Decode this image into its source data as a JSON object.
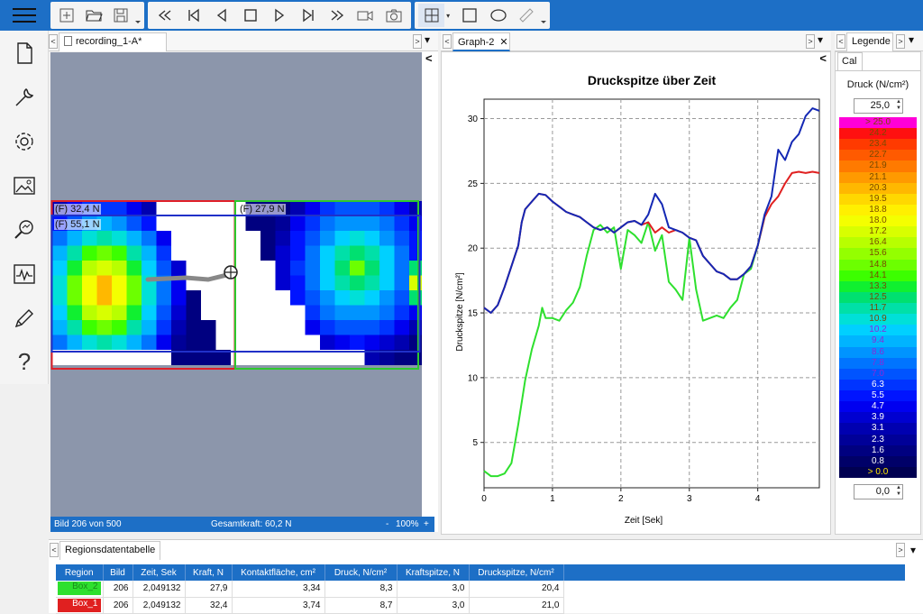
{
  "toolbar": {
    "buttons": [
      "add-icon",
      "folder-open-icon",
      "save-icon",
      "fast-rewind-icon",
      "skip-start-icon",
      "step-back-icon",
      "stop-icon",
      "play-icon",
      "skip-end-icon",
      "fast-forward-icon",
      "video-camera-icon",
      "camera-icon",
      "grid-icon",
      "rectangle-icon",
      "ellipse-icon",
      "ruler-icon"
    ]
  },
  "sidebar": {
    "items": [
      "file-icon",
      "wrench-icon",
      "gear-icon",
      "image-icon",
      "zoom-analysis-icon",
      "chart-icon",
      "pencil-icon",
      "help-icon"
    ],
    "help_glyph": "?"
  },
  "tabs": {
    "recording": "recording_1-A*",
    "graph": "Graph-2",
    "graph_close": "✕",
    "legend": "Legende",
    "cal": "Cal",
    "regions": "Regionsdatentabelle",
    "left_arrow": "<",
    "right_arrow": ">",
    "menu_arrow": "▾"
  },
  "image": {
    "box_f1": "(F) 32,4 N",
    "box_f2": "(F) 55,1 N",
    "box_f3": "(F) 27,9 N",
    "colors": {
      "red": "#e0202a",
      "green": "#2ec82e",
      "blue": "#2030c8"
    }
  },
  "status": {
    "frame": "Bild 206 von 500",
    "total_force": "Gesamtkraft: 60,2 N",
    "zoom_minus": "-",
    "zoom": "100%",
    "zoom_plus": "+"
  },
  "legend": {
    "unit": "Druck (N/cm²)",
    "max_value": "25,0",
    "min_value": "0,0",
    "labels": [
      "> 25.0",
      "24.2",
      "23.4",
      "22.7",
      "21.9",
      "21.1",
      "20.3",
      "19.5",
      "18.8",
      "18.0",
      "17.2",
      "16.4",
      "15.6",
      "14.8",
      "14.1",
      "13.3",
      "12.5",
      "11.7",
      "10.9",
      "10.2",
      "9.4",
      "8.6",
      "7.8",
      "7.0",
      "6.3",
      "5.5",
      "4.7",
      "3.9",
      "3.1",
      "2.3",
      "1.6",
      "0.8",
      "> 0.0"
    ],
    "colors": [
      "#ff00d8",
      "#ff1010",
      "#ff3a00",
      "#ff5a00",
      "#ff7a00",
      "#ff9a00",
      "#ffb800",
      "#ffd800",
      "#fff000",
      "#f4ff00",
      "#d8ff00",
      "#b8ff00",
      "#94ff00",
      "#6cff00",
      "#3cff00",
      "#10f030",
      "#00e070",
      "#00e0a8",
      "#00e0d8",
      "#00d0ff",
      "#00b4ff",
      "#0094ff",
      "#0074ff",
      "#0054ff",
      "#0034ff",
      "#0014ff",
      "#0000f0",
      "#0000d0",
      "#0000b0",
      "#000098",
      "#000080",
      "#000068",
      "#000050"
    ]
  },
  "chart_data": {
    "type": "line",
    "title": "Druckspitze über Zeit",
    "xlabel": "Zeit [Sek]",
    "ylabel": "Druckspitze [N/cm²]",
    "xlim": [
      0,
      4.9
    ],
    "ylim": [
      1.5,
      31.5
    ],
    "xticks": [
      0,
      1,
      2,
      3,
      4
    ],
    "yticks": [
      5,
      10,
      15,
      20,
      25,
      30
    ],
    "grid": true,
    "series": [
      {
        "color": "#1428b4",
        "points": [
          [
            0,
            15.4
          ],
          [
            0.1,
            15.0
          ],
          [
            0.2,
            15.6
          ],
          [
            0.3,
            17.0
          ],
          [
            0.4,
            18.6
          ],
          [
            0.5,
            20.2
          ],
          [
            0.55,
            22.0
          ],
          [
            0.6,
            23.0
          ],
          [
            0.7,
            23.6
          ],
          [
            0.8,
            24.2
          ],
          [
            0.9,
            24.1
          ],
          [
            1.0,
            23.6
          ],
          [
            1.1,
            23.2
          ],
          [
            1.2,
            22.8
          ],
          [
            1.3,
            22.6
          ],
          [
            1.4,
            22.4
          ],
          [
            1.5,
            22.0
          ],
          [
            1.6,
            21.6
          ],
          [
            1.7,
            21.4
          ],
          [
            1.8,
            21.6
          ],
          [
            1.9,
            21.2
          ],
          [
            2.0,
            21.6
          ],
          [
            2.1,
            22.0
          ],
          [
            2.2,
            22.1
          ],
          [
            2.3,
            21.8
          ],
          [
            2.4,
            22.6
          ],
          [
            2.5,
            24.2
          ],
          [
            2.6,
            23.4
          ],
          [
            2.7,
            21.6
          ],
          [
            2.8,
            21.4
          ],
          [
            2.9,
            21.2
          ],
          [
            3.0,
            20.8
          ],
          [
            3.1,
            20.6
          ],
          [
            3.2,
            19.4
          ],
          [
            3.3,
            18.8
          ],
          [
            3.4,
            18.2
          ],
          [
            3.5,
            18.0
          ],
          [
            3.6,
            17.6
          ],
          [
            3.7,
            17.6
          ],
          [
            3.8,
            18.0
          ],
          [
            3.9,
            18.6
          ],
          [
            4.0,
            20.2
          ],
          [
            4.1,
            22.6
          ],
          [
            4.2,
            24.0
          ],
          [
            4.3,
            27.6
          ],
          [
            4.4,
            26.8
          ],
          [
            4.5,
            28.2
          ],
          [
            4.6,
            28.8
          ],
          [
            4.7,
            30.2
          ],
          [
            4.8,
            30.8
          ],
          [
            4.9,
            30.6
          ]
        ]
      },
      {
        "color": "#e02020",
        "points": [
          [
            0,
            15.4
          ],
          [
            0.1,
            15.0
          ],
          [
            0.2,
            15.6
          ],
          [
            0.3,
            17.0
          ],
          [
            0.4,
            18.6
          ],
          [
            0.5,
            20.2
          ],
          [
            0.55,
            22.0
          ],
          [
            0.6,
            23.0
          ],
          [
            0.7,
            23.6
          ],
          [
            0.8,
            24.2
          ],
          [
            0.9,
            24.1
          ],
          [
            1.0,
            23.6
          ],
          [
            1.1,
            23.2
          ],
          [
            1.2,
            22.8
          ],
          [
            1.3,
            22.6
          ],
          [
            1.4,
            22.4
          ],
          [
            1.5,
            22.0
          ],
          [
            1.6,
            21.6
          ],
          [
            1.7,
            21.4
          ],
          [
            1.8,
            21.6
          ],
          [
            1.9,
            21.2
          ],
          [
            2.0,
            21.6
          ],
          [
            2.1,
            22.0
          ],
          [
            2.2,
            22.1
          ],
          [
            2.3,
            21.8
          ],
          [
            2.4,
            22.0
          ],
          [
            2.5,
            21.2
          ],
          [
            2.6,
            21.6
          ],
          [
            2.7,
            21.2
          ],
          [
            2.8,
            21.4
          ],
          [
            2.9,
            21.2
          ],
          [
            3.0,
            20.8
          ],
          [
            3.1,
            20.6
          ],
          [
            3.2,
            19.4
          ],
          [
            3.3,
            18.8
          ],
          [
            3.4,
            18.2
          ],
          [
            3.5,
            18.0
          ],
          [
            3.6,
            17.6
          ],
          [
            3.7,
            17.6
          ],
          [
            3.8,
            18.0
          ],
          [
            3.9,
            18.6
          ],
          [
            4.0,
            20.2
          ],
          [
            4.1,
            22.4
          ],
          [
            4.2,
            23.4
          ],
          [
            4.3,
            24.0
          ],
          [
            4.4,
            25.0
          ],
          [
            4.5,
            25.8
          ],
          [
            4.6,
            25.9
          ],
          [
            4.7,
            25.8
          ],
          [
            4.8,
            25.9
          ],
          [
            4.9,
            25.8
          ]
        ]
      },
      {
        "color": "#2ee02e",
        "points": [
          [
            0,
            2.8
          ],
          [
            0.1,
            2.4
          ],
          [
            0.2,
            2.4
          ],
          [
            0.3,
            2.6
          ],
          [
            0.4,
            3.4
          ],
          [
            0.5,
            6.4
          ],
          [
            0.6,
            9.8
          ],
          [
            0.7,
            12.2
          ],
          [
            0.8,
            14.0
          ],
          [
            0.85,
            15.4
          ],
          [
            0.9,
            14.6
          ],
          [
            1.0,
            14.6
          ],
          [
            1.1,
            14.4
          ],
          [
            1.2,
            15.2
          ],
          [
            1.3,
            15.8
          ],
          [
            1.4,
            17.0
          ],
          [
            1.5,
            19.4
          ],
          [
            1.6,
            21.4
          ],
          [
            1.7,
            21.8
          ],
          [
            1.8,
            21.2
          ],
          [
            1.9,
            21.6
          ],
          [
            2.0,
            18.4
          ],
          [
            2.1,
            21.4
          ],
          [
            2.2,
            21.0
          ],
          [
            2.3,
            20.4
          ],
          [
            2.4,
            22.0
          ],
          [
            2.5,
            19.8
          ],
          [
            2.6,
            21.0
          ],
          [
            2.7,
            17.4
          ],
          [
            2.8,
            16.8
          ],
          [
            2.9,
            16.0
          ],
          [
            3.0,
            20.8
          ],
          [
            3.1,
            16.8
          ],
          [
            3.2,
            14.4
          ],
          [
            3.3,
            14.6
          ],
          [
            3.4,
            14.8
          ],
          [
            3.5,
            14.6
          ],
          [
            3.6,
            15.4
          ],
          [
            3.7,
            16.0
          ],
          [
            3.8,
            18.0
          ],
          [
            3.9,
            18.4
          ],
          [
            4.0,
            20.2
          ],
          [
            4.1,
            22.4
          ]
        ]
      }
    ]
  },
  "table": {
    "headers": [
      "Region",
      "Bild",
      "Zeit, Sek",
      "Kraft, N",
      "Kontaktfläche, cm²",
      "Druck, N/cm²",
      "Kraftspitze, N",
      "Druckspitze, N/cm²"
    ],
    "rows": [
      {
        "region": "Box_2",
        "color": "#2ee02e",
        "bild": "206",
        "zeit": "2,049132",
        "kraft": "27,9",
        "flaeche": "3,34",
        "druck": "8,3",
        "kraftspitze": "3,0",
        "druckspitze": "20,4"
      },
      {
        "region": "Box_1",
        "color": "#e02020",
        "bild": "206",
        "zeit": "2,049132",
        "kraft": "32,4",
        "flaeche": "3,74",
        "druck": "8,7",
        "kraftspitze": "3,0",
        "druckspitze": "21,0"
      }
    ]
  }
}
